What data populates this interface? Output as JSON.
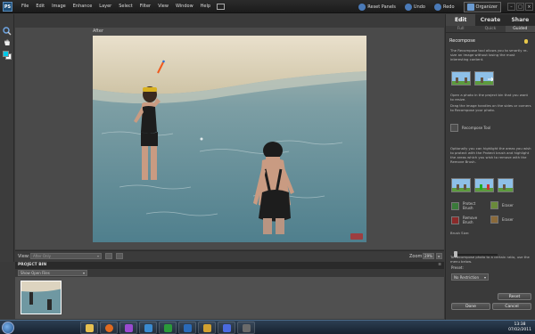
{
  "app": {
    "logo_text": "PS"
  },
  "menu": [
    "File",
    "Edit",
    "Image",
    "Enhance",
    "Layer",
    "Select",
    "Filter",
    "View",
    "Window",
    "Help"
  ],
  "topbar": {
    "reset_panels": "Reset Panels",
    "undo": "Undo",
    "redo": "Redo",
    "organizer": "Organizer"
  },
  "canvas": {
    "label": "After"
  },
  "viewbar": {
    "view_label": "View:",
    "view_value": "After Only",
    "zoom_label": "Zoom:",
    "zoom_value": "29%"
  },
  "project_bin": {
    "title": "PROJECT BIN",
    "filter": "Show Open Files"
  },
  "panel": {
    "tabs": [
      "Edit",
      "Create",
      "Share"
    ],
    "subtabs": [
      "Full",
      "Quick",
      "Guided"
    ],
    "title": "Recompose",
    "intro": "The Recompose tool allows you to smartly re-size an image without losing the most interesting content.",
    "step1": "Open a photo in the project bin that you want to resize.",
    "step2": "Drag the image handles on the sides or corners to Recompose your photo.",
    "tool_label": "Recompose Tool",
    "step3": "Optionally you can highlight the areas you wish to protect with the Protect brush and highlight the areas which you wish to remove with the Remove Brush.",
    "protect_brush": "Protect Brush",
    "eraser": "Eraser",
    "remove_brush": "Remove Brush",
    "brush_size": "Brush Size:",
    "ratio_text": "To Recompose photo to a certain ratio, use the menu below.",
    "preset_label": "Preset:",
    "preset_value": "No Restriction",
    "reset": "Reset",
    "done": "Done",
    "cancel": "Cancel"
  },
  "taskbar": {
    "time": "13:38",
    "date": "07/02/2011"
  },
  "colors": {
    "accent": "#1f4f78",
    "panel": "#3a3a3a",
    "canvas_bg": "#4a4a4a"
  }
}
